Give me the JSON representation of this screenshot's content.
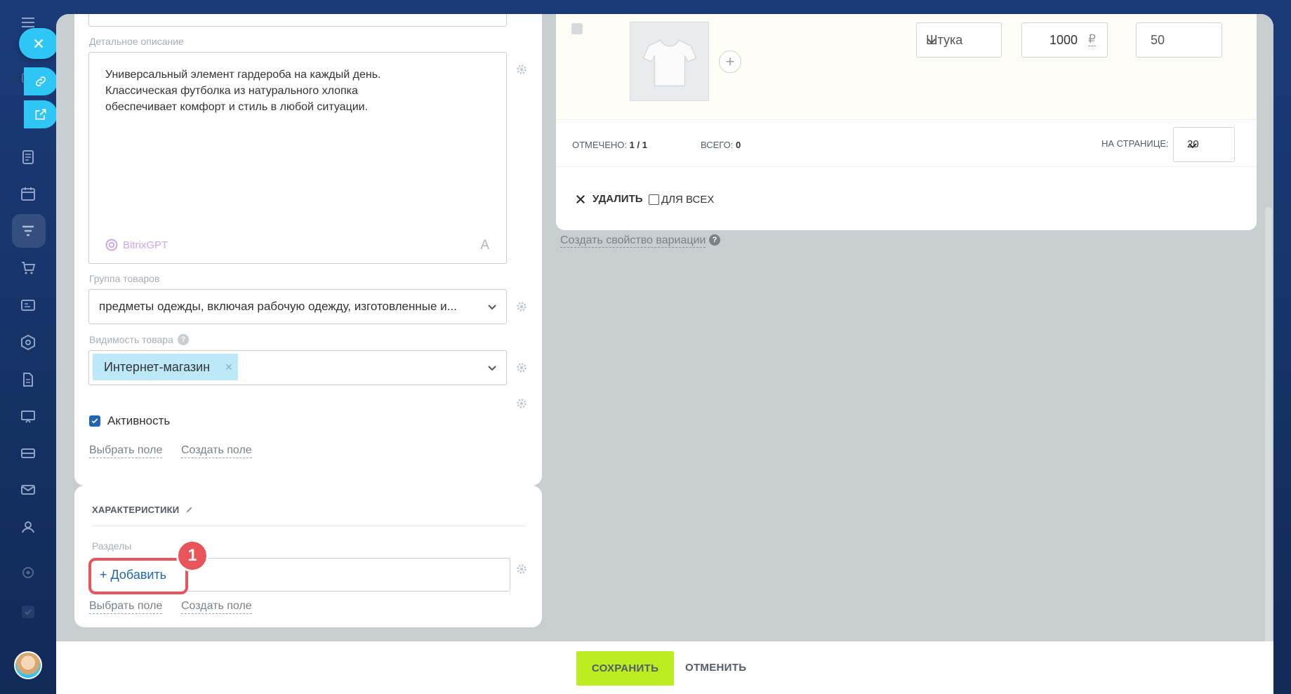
{
  "description": {
    "label": "Детальное описание",
    "text": "Универсальный элемент гардероба на каждый день. Классическая футболка из натурального хлопка обеспечивает комфорт и стиль в любой ситуации.",
    "ai_label": "BitrixGPT",
    "format_glyph": "A"
  },
  "product_group": {
    "label": "Группа товаров",
    "value": "предметы одежды, включая рабочую одежду, изготовленные и..."
  },
  "visibility": {
    "label": "Видимость товара",
    "help": "?",
    "tag": "Интернет-магазин",
    "tag_remove": "×"
  },
  "activity": {
    "label": "Активность",
    "checked": true
  },
  "main_links": {
    "choose": "Выбрать поле",
    "create": "Создать поле"
  },
  "characteristics": {
    "title": "ХАРАКТЕРИСТИКИ",
    "sections_label": "Разделы",
    "add_label": "+ Добавить",
    "badge": "1",
    "choose": "Выбрать поле",
    "create": "Создать поле"
  },
  "variation": {
    "unit": "Штука",
    "price": "1000",
    "currency": "₽",
    "quantity": "50",
    "plus": "+"
  },
  "grid_stats": {
    "selected_label": "ОТМЕЧЕНО:",
    "selected_value": "1 / 1",
    "total_label": "ВСЕГО:",
    "total_value": "0",
    "per_page_label": "НА СТРАНИЦЕ:",
    "per_page_value": "20"
  },
  "grid_actions": {
    "delete": "УДАЛИТЬ",
    "for_all": "ДЛЯ ВСЕХ"
  },
  "create_variation_property": "Создать свойство вариации",
  "help_glyph": "?",
  "footer": {
    "save": "СОХРАНИТЬ",
    "cancel": "ОТМЕНИТЬ"
  },
  "colors": {
    "accent": "#2fc6f6",
    "save": "#bbed21",
    "highlight": "#e8545a",
    "link": "#2066b0"
  },
  "sidebar_icons": [
    "menu-icon",
    "link-icon",
    "external-link-icon",
    "document-icon",
    "calendar-icon",
    "funnel-icon",
    "cart-icon",
    "contact-card-icon",
    "hexagon-icon",
    "file-icon",
    "presentation-icon",
    "inbox-icon",
    "mail-icon",
    "users-icon",
    "settings-icon",
    "check-icon"
  ]
}
